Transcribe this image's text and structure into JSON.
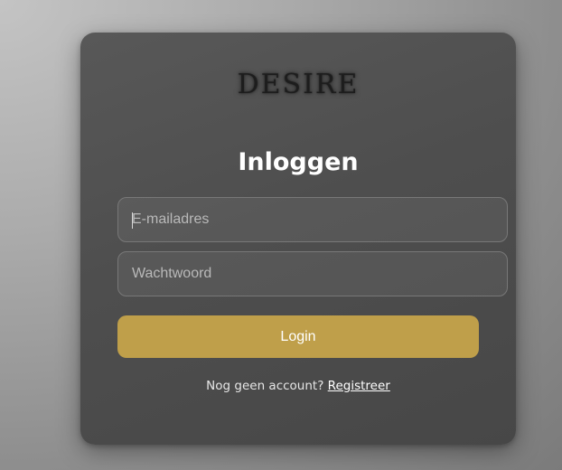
{
  "brand": {
    "logo_text": "DESIRE"
  },
  "login_form": {
    "title": "Inloggen",
    "email": {
      "value": "",
      "placeholder": "E-mailadres"
    },
    "password": {
      "value": "",
      "placeholder": "Wachtwoord"
    },
    "submit_label": "Login",
    "footer": {
      "prompt": "Nog geen account?",
      "register_link": "Registreer"
    }
  },
  "colors": {
    "accent": "#bf9f4a",
    "card_background": "#4e4e4e",
    "page_background": "#a3a3a3",
    "text_primary": "#ffffff"
  }
}
